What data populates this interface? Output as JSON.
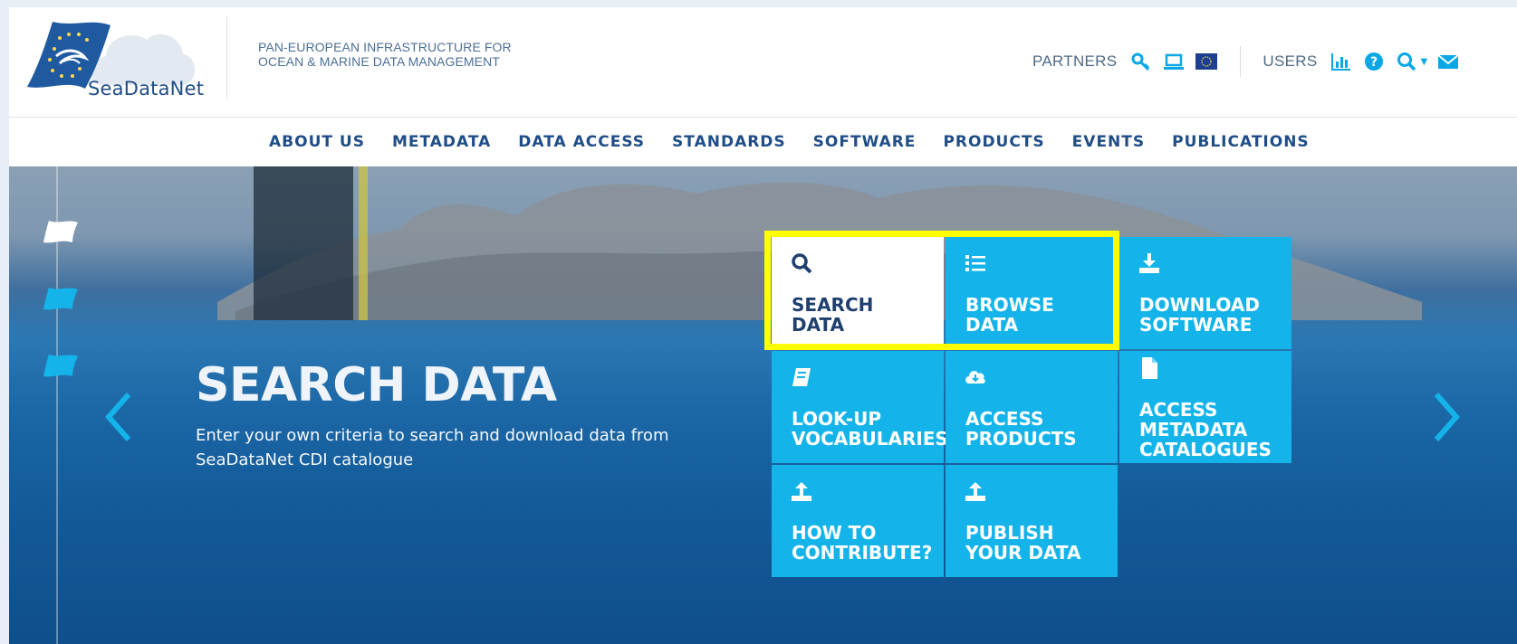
{
  "brand": {
    "name": "SeaDataNet",
    "tagline_line1": "PAN-EUROPEAN INFRASTRUCTURE FOR",
    "tagline_line2": "OCEAN & MARINE DATA MANAGEMENT"
  },
  "utility_bar": {
    "partners_label": "PARTNERS",
    "users_label": "USERS",
    "partner_icons": [
      "key-icon",
      "laptop-icon",
      "eu-flag-icon"
    ],
    "user_icons": [
      "bar-chart-icon",
      "question-circle-icon",
      "search-dropdown-icon",
      "envelope-icon"
    ]
  },
  "nav": {
    "items": [
      "ABOUT US",
      "METADATA",
      "DATA ACCESS",
      "STANDARDS",
      "SOFTWARE",
      "PRODUCTS",
      "EVENTS",
      "PUBLICATIONS"
    ]
  },
  "hero": {
    "title": "SEARCH DATA",
    "description": "Enter your own criteria to search and download data from SeaDataNet CDI catalogue"
  },
  "tiles": [
    {
      "line1": "SEARCH",
      "line2": "DATA",
      "line3": "",
      "icon": "search-icon",
      "active": true
    },
    {
      "line1": "BROWSE",
      "line2": "DATA",
      "line3": "",
      "icon": "list-icon",
      "active": false
    },
    {
      "line1": "DOWNLOAD",
      "line2": "SOFTWARE",
      "line3": "",
      "icon": "download-icon",
      "active": false
    },
    {
      "line1": "LOOK-UP",
      "line2": "VOCABULARIES",
      "line3": "",
      "icon": "book-icon",
      "active": false
    },
    {
      "line1": "ACCESS",
      "line2": "PRODUCTS",
      "line3": "",
      "icon": "cloud-download-icon",
      "active": false
    },
    {
      "line1": "ACCESS",
      "line2": "METADATA",
      "line3": "CATALOGUES",
      "icon": "file-icon",
      "active": false
    },
    {
      "line1": "HOW TO",
      "line2": "CONTRIBUTE?",
      "line3": "",
      "icon": "upload-icon",
      "active": false
    },
    {
      "line1": "PUBLISH",
      "line2": "YOUR DATA",
      "line3": "",
      "icon": "upload-icon",
      "active": false
    }
  ],
  "colors": {
    "brand_blue": "#1f4d87",
    "tile_cyan": "#14b4ea",
    "highlight_yellow": "#ffff00",
    "icon_cyan": "#0aa7e6"
  }
}
